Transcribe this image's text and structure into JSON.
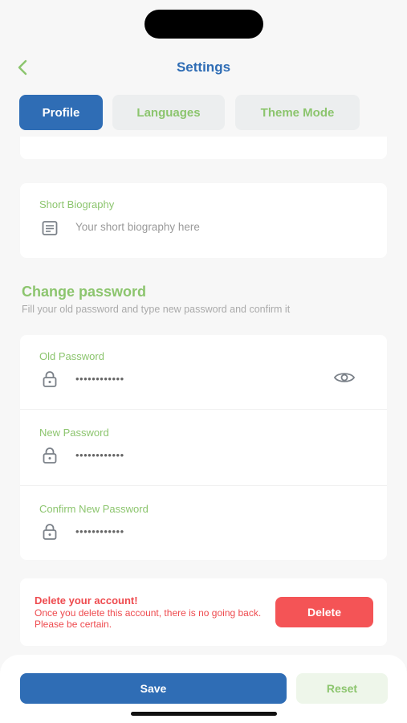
{
  "header": {
    "title": "Settings"
  },
  "tabs": [
    {
      "label": "Profile",
      "active": true
    },
    {
      "label": "Languages",
      "active": false
    },
    {
      "label": "Theme Mode",
      "active": false
    }
  ],
  "bio": {
    "label": "Short Biography",
    "placeholder": "Your short biography here",
    "icon": "notes-icon"
  },
  "change_password": {
    "title": "Change password",
    "subtitle": "Fill your old password and type new password and confirm it",
    "fields": [
      {
        "label": "Old Password",
        "value": "••••••••••••",
        "icon": "lock-icon",
        "has_eye": true
      },
      {
        "label": "New Password",
        "value": "••••••••••••",
        "icon": "lock-icon",
        "has_eye": false
      },
      {
        "label": "Confirm New Password",
        "value": "••••••••••••",
        "icon": "lock-icon",
        "has_eye": false
      }
    ]
  },
  "delete_account": {
    "title": "Delete your account!",
    "text": "Once you delete this account, there is no going back. Please be certain.",
    "button": "Delete"
  },
  "footer": {
    "save": "Save",
    "reset": "Reset"
  },
  "colors": {
    "primary": "#2f6db5",
    "accent_green": "#8cc56e",
    "danger": "#f45456",
    "background": "#f7f7f7"
  }
}
